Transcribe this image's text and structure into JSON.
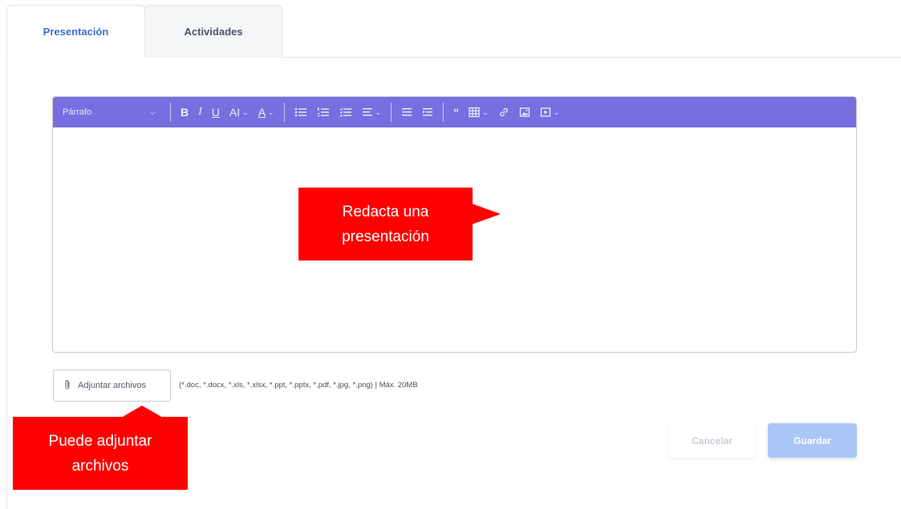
{
  "tabs": [
    {
      "label": "Presentación",
      "active": true
    },
    {
      "label": "Actividades",
      "active": false
    }
  ],
  "editor": {
    "paragraph_select": "Párrafo",
    "toolbar_icons": [
      "bold-icon",
      "italic-icon",
      "underline-icon",
      "font-size-icon",
      "font-color-icon",
      "bulleted-list-icon",
      "numbered-list-icon",
      "todo-list-icon",
      "align-icon",
      "outdent-icon",
      "indent-icon",
      "blockquote-icon",
      "table-icon",
      "link-icon",
      "image-icon",
      "media-icon"
    ],
    "toolbar_color": "#776ee0"
  },
  "attach": {
    "button_label": "Adjuntar archivos",
    "formats": "(*.doc, *.docx, *.xls, *.xlsx, *.ppt, *.pptx, *.pdf, *.jpg, *.png) | Máx. 20MB"
  },
  "actions": {
    "cancel": "Cancelar",
    "save": "Guardar"
  },
  "callouts": {
    "editor_line1": "Redacta una",
    "editor_line2": "presentación",
    "attach_line1": "Puede adjuntar",
    "attach_line2": "archivos",
    "color": "#ff0000"
  }
}
